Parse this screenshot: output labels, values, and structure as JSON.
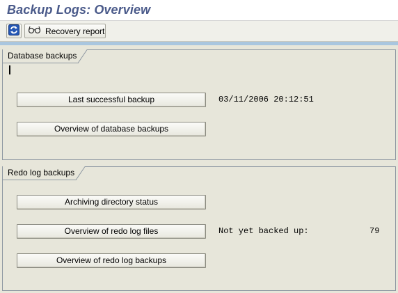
{
  "window": {
    "title": "Backup Logs: Overview"
  },
  "toolbar": {
    "refresh_icon": "refresh-icon",
    "recovery_icon": "glasses-icon",
    "recovery_label": "Recovery report"
  },
  "database_backups": {
    "title": "Database backups",
    "last_successful_label": "Last successful backup",
    "last_successful_value": "03/11/2006 20:12:51",
    "overview_label": "Overview of database backups"
  },
  "redo_log_backups": {
    "title": "Redo log backups",
    "archiving_label": "Archiving directory status",
    "overview_files_label": "Overview of redo log files",
    "not_backed_up_label": "Not yet backed up:",
    "not_backed_up_count": "79",
    "overview_backups_label": "Overview of redo log backups"
  },
  "colors": {
    "title": "#4a5a8a",
    "background": "#e7e6da",
    "accent_strip": "#a9c6df",
    "refresh_icon_blue": "#2456b4"
  }
}
